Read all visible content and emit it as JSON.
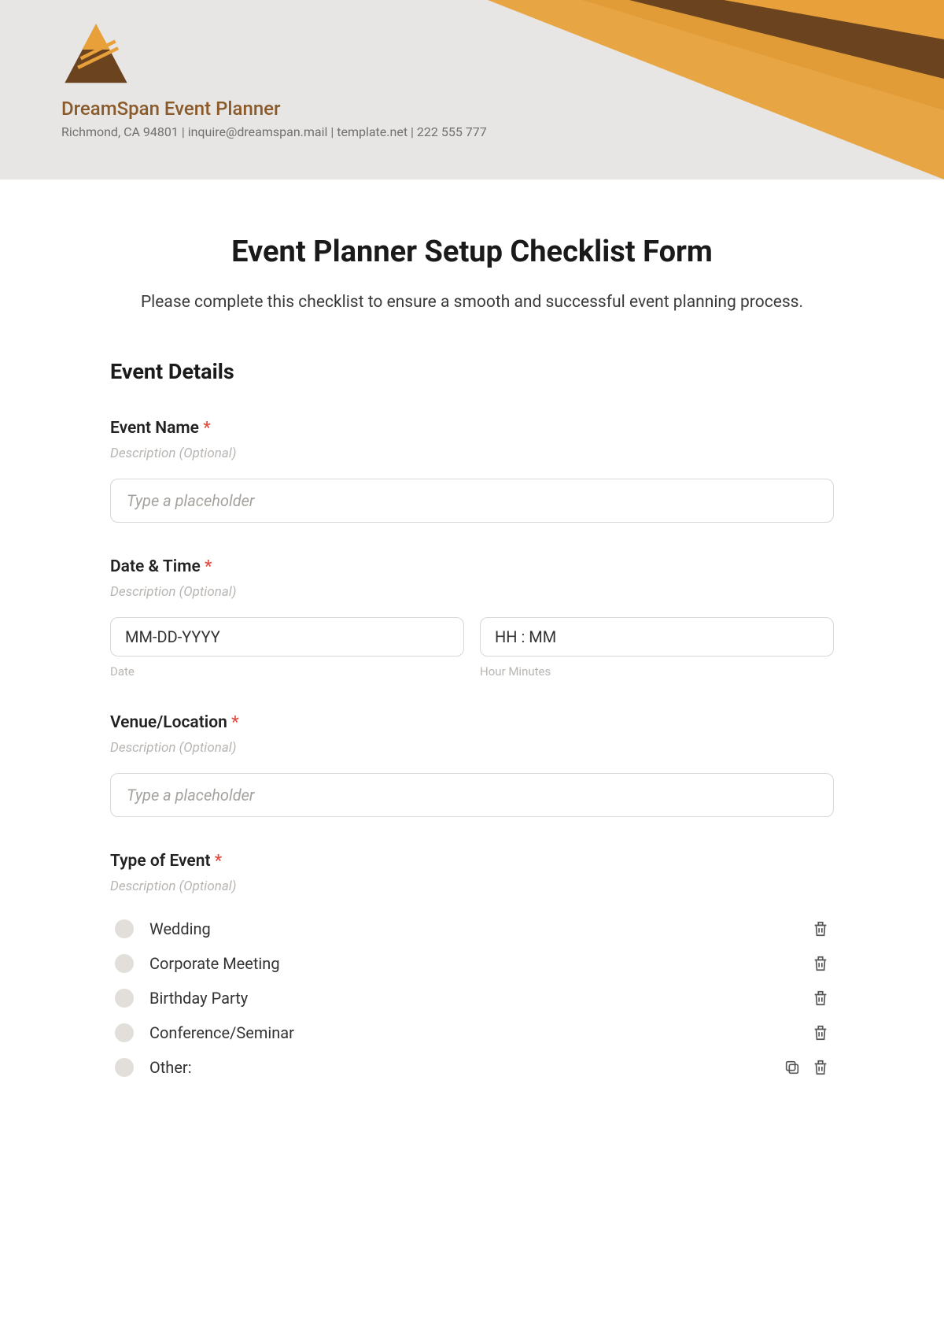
{
  "header": {
    "company_name": "DreamSpan Event Planner",
    "company_sub": "Richmond, CA 94801 | inquire@dreamspan.mail | template.net | 222 555 777"
  },
  "form": {
    "title": "Event Planner Setup Checklist Form",
    "subtitle": "Please complete this checklist to ensure a smooth and successful event planning process.",
    "section_heading": "Event Details",
    "required_mark": "*",
    "desc_placeholder": "Description (Optional)",
    "fields": {
      "event_name": {
        "label": "Event Name",
        "placeholder": "Type a placeholder"
      },
      "date_time": {
        "label": "Date & Time",
        "date_placeholder": "MM-DD-YYYY",
        "time_placeholder": "HH : MM",
        "date_sub": "Date",
        "time_sub": "Hour Minutes"
      },
      "venue": {
        "label": "Venue/Location",
        "placeholder": "Type a placeholder"
      },
      "type_of_event": {
        "label": "Type of Event",
        "options": [
          "Wedding",
          "Corporate Meeting",
          "Birthday Party",
          "Conference/Seminar",
          "Other:"
        ]
      }
    }
  }
}
